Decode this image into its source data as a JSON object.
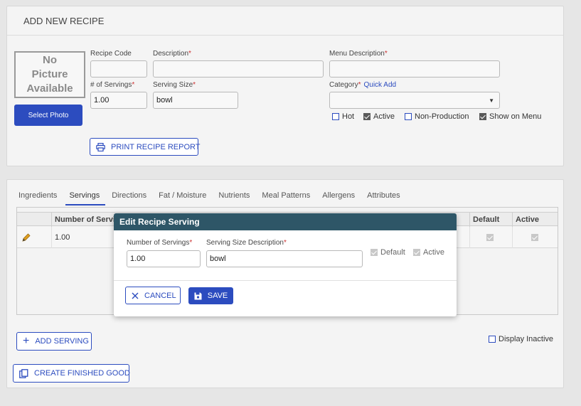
{
  "header": {
    "title": "ADD NEW RECIPE"
  },
  "photo": {
    "placeholder": "No\nPicture\nAvailable",
    "select_label": "Select Photo"
  },
  "form": {
    "recipe_code": {
      "label": "Recipe Code",
      "value": ""
    },
    "description": {
      "label": "Description",
      "required": "*",
      "value": ""
    },
    "menu_description": {
      "label": "Menu Description",
      "required": "*",
      "value": ""
    },
    "num_servings": {
      "label": "# of Servings",
      "required": "*",
      "value": "1.00"
    },
    "serving_size": {
      "label": "Serving Size",
      "required": "*",
      "value": "bowl"
    },
    "category": {
      "label": "Category",
      "required": "*",
      "quick_add": "Quick Add",
      "value": ""
    },
    "checks": [
      {
        "label": "Hot",
        "checked": false
      },
      {
        "label": "Active",
        "checked": true
      },
      {
        "label": "Non-Production",
        "checked": false
      },
      {
        "label": "Show on Menu",
        "checked": true
      }
    ],
    "print_label": "PRINT RECIPE REPORT"
  },
  "tabs": [
    "Ingredients",
    "Servings",
    "Directions",
    "Fat / Moisture",
    "Nutrients",
    "Meal Patterns",
    "Allergens",
    "Attributes"
  ],
  "active_tab": "Servings",
  "grid": {
    "columns": [
      "Number of Servings",
      "Default",
      "Active"
    ],
    "rows": [
      {
        "servings": "1.00",
        "default": true,
        "active": true
      }
    ]
  },
  "bottom": {
    "add_serving_label": "ADD SERVING",
    "display_inactive_label": "Display Inactive",
    "create_finished_label": "CREATE FINISHED GOOD"
  },
  "modal": {
    "title": "Edit Recipe Serving",
    "num_servings_label": "Number of Servings",
    "num_servings_value": "1.00",
    "desc_label": "Serving Size Description",
    "desc_value": "bowl",
    "required": "*",
    "default_label": "Default",
    "active_label": "Active",
    "cancel_label": "CANCEL",
    "save_label": "SAVE"
  },
  "colors": {
    "accent": "#2c4cbf",
    "modal_header": "#2e5667",
    "required": "#cc3333"
  }
}
